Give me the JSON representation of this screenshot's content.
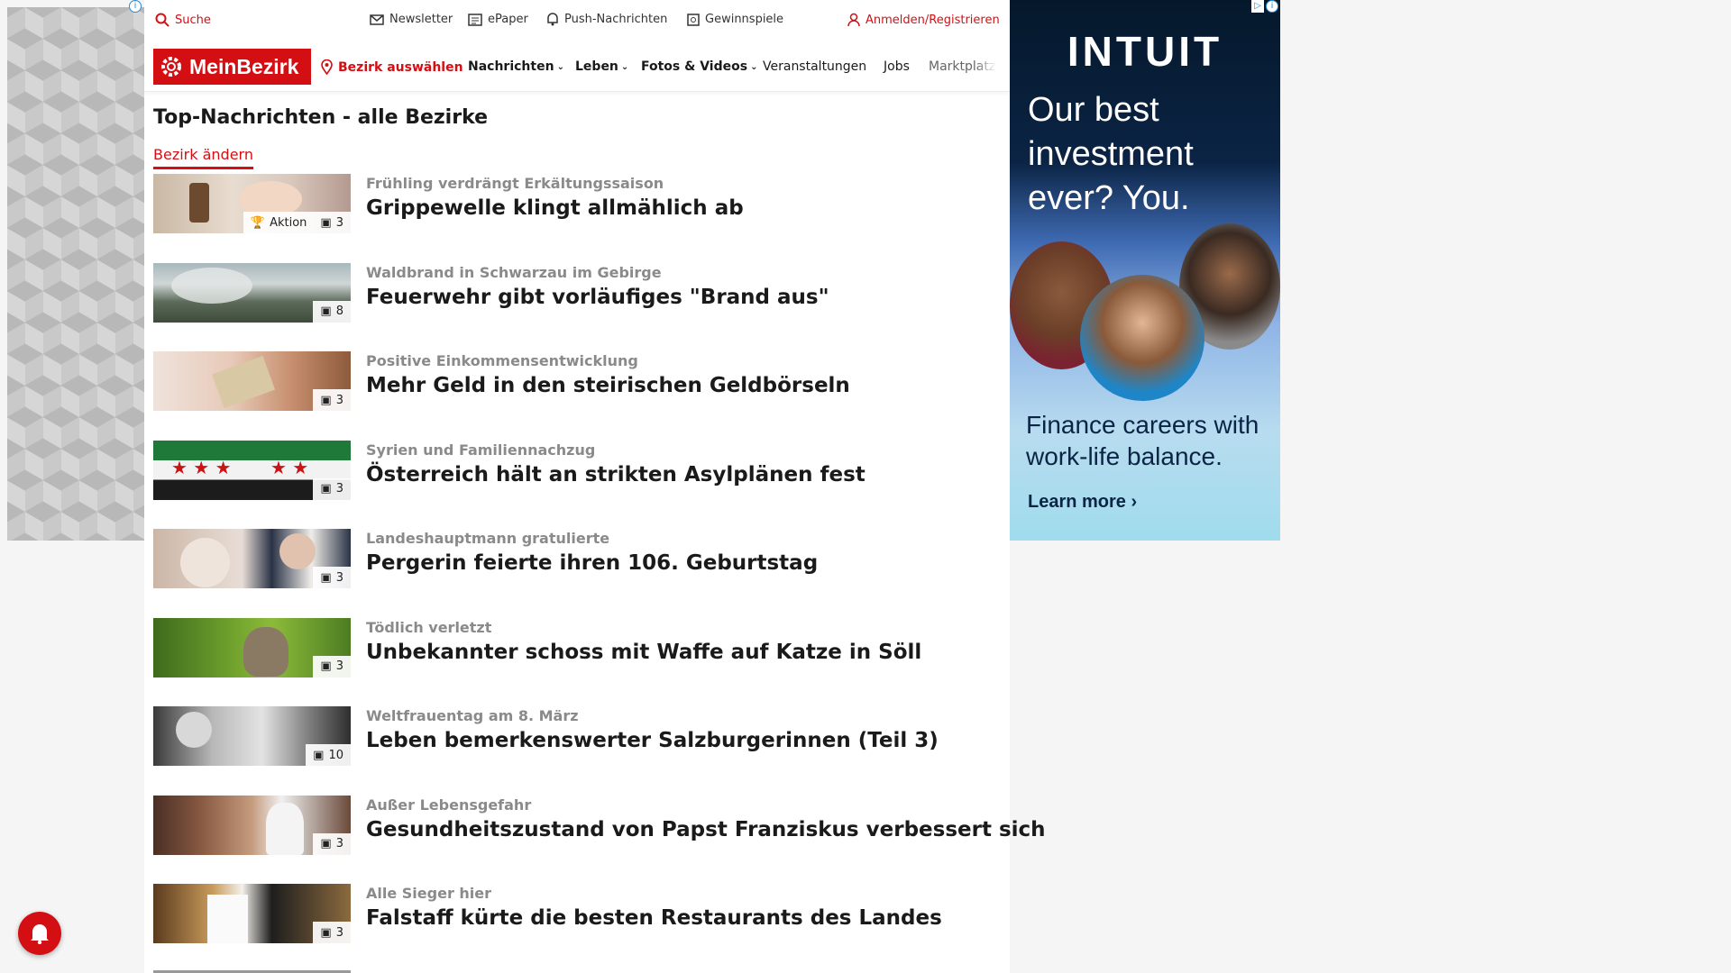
{
  "topbar": {
    "search_label": "Suche",
    "newsletter_label": "Newsletter",
    "epaper_label": "ePaper",
    "push_label": "Push-Nachrichten",
    "gewinnspiele_label": "Gewinnspiele",
    "login_label": "Anmelden/Registrieren"
  },
  "nav": {
    "logo_text": "MeinBezirk",
    "bezirk_select": "Bezirk auswählen",
    "items": [
      {
        "label": "Nachrichten"
      },
      {
        "label": "Leben"
      },
      {
        "label": "Fotos & Videos"
      },
      {
        "label": "Veranstaltungen"
      },
      {
        "label": "Jobs"
      },
      {
        "label": "Marktplatz"
      }
    ]
  },
  "main": {
    "title": "Top-Nachrichten - alle Bezirke",
    "bezirk_change": "Bezirk ändern",
    "articles": [
      {
        "kicker": "Frühling verdrängt Erkältungssaison",
        "headline": "Grippewelle klingt allmählich ab",
        "badge_extra": "Aktion",
        "photo_count": "3"
      },
      {
        "kicker": "Waldbrand in Schwarzau im Gebirge",
        "headline": "Feuerwehr gibt vorläufiges \"Brand aus\"",
        "photo_count": "8"
      },
      {
        "kicker": "Positive Einkommensentwicklung",
        "headline": "Mehr Geld in den steirischen Geldbörseln",
        "photo_count": "3"
      },
      {
        "kicker": "Syrien und Familiennachzug",
        "headline": "Österreich hält an strikten Asylplänen fest",
        "photo_count": "3"
      },
      {
        "kicker": "Landeshauptmann gratulierte",
        "headline": "Pergerin feierte ihren 106. Geburtstag",
        "photo_count": "3"
      },
      {
        "kicker": "Tödlich verletzt",
        "headline": "Unbekannter schoss mit Waffe auf Katze in Söll",
        "photo_count": "3"
      },
      {
        "kicker": "Weltfrauentag am 8. März",
        "headline": "Leben bemerkenswerter Salzburgerinnen (Teil 3)",
        "photo_count": "10"
      },
      {
        "kicker": "Außer Lebensgefahr",
        "headline": "Gesundheitszustand von Papst Franziskus verbessert sich",
        "photo_count": "3"
      },
      {
        "kicker": "Alle Sieger hier",
        "headline": "Falstaff kürte die besten Restaurants des Landes",
        "photo_count": "3"
      }
    ]
  },
  "right_ad": {
    "brand": "INTUIT",
    "tagline": "Our best investment ever? You.",
    "subline": "Finance careers with work-life balance.",
    "cta": "Learn more ›"
  },
  "colors": {
    "accent": "#d40f14",
    "ad_dark": "#0b2445"
  }
}
